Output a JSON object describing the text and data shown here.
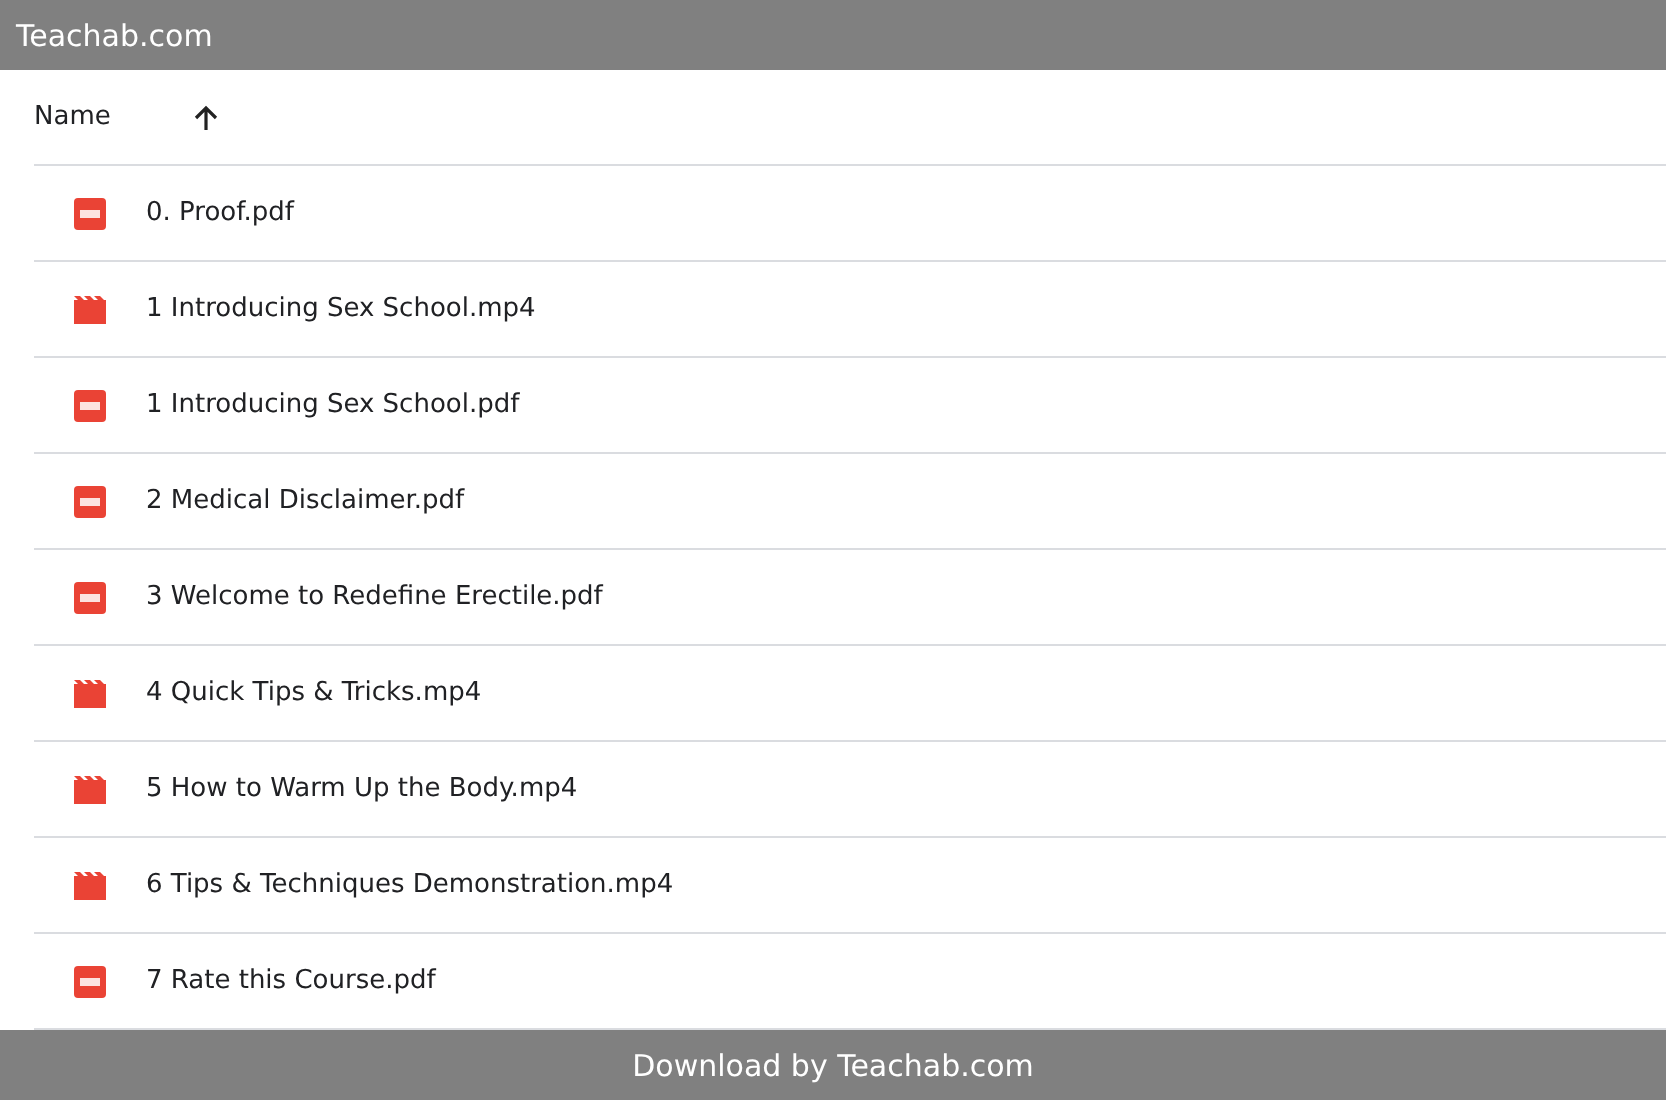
{
  "top_bar": {
    "title": "Teachab.com"
  },
  "table": {
    "columns": [
      {
        "label": "Name",
        "sorted_ascending": true
      }
    ],
    "rows": [
      {
        "kind": "pdf",
        "name": "0. Proof.pdf"
      },
      {
        "kind": "video",
        "name": "1 Introducing Sex School.mp4"
      },
      {
        "kind": "pdf",
        "name": "1 Introducing Sex School.pdf"
      },
      {
        "kind": "pdf",
        "name": "2 Medical Disclaimer.pdf"
      },
      {
        "kind": "pdf",
        "name": "3 Welcome to Redefine Erectile.pdf"
      },
      {
        "kind": "video",
        "name": "4 Quick Tips & Tricks.mp4"
      },
      {
        "kind": "video",
        "name": "5 How to Warm Up the Body.mp4"
      },
      {
        "kind": "video",
        "name": "6 Tips & Techniques Demonstration.mp4"
      },
      {
        "kind": "pdf",
        "name": "7 Rate this Course.pdf"
      }
    ]
  },
  "bottom_bar": {
    "text": "Download by Teachab.com"
  }
}
